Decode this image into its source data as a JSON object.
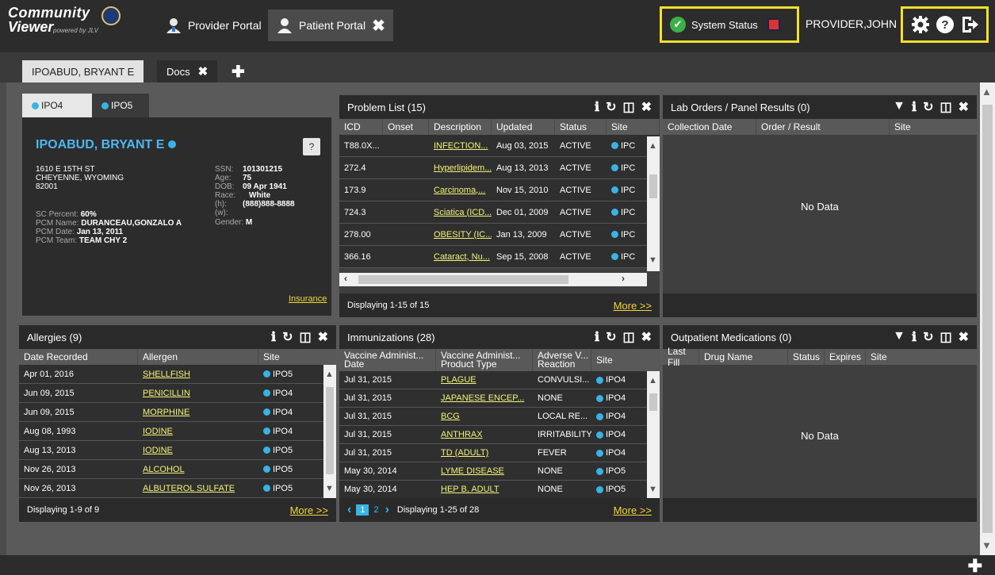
{
  "app": {
    "logo_line1": "Community",
    "logo_line2": "Viewer",
    "logo_sub": "powered by JLV",
    "portal_tabs": [
      "Provider Portal",
      "Patient Portal"
    ],
    "system_status": "System Status",
    "user": "PROVIDER,JOHN",
    "accent_color": "#f2e12a"
  },
  "patient_tabs": {
    "active": "IPOABUD, BRYANT E",
    "docs": "Docs"
  },
  "demographics": {
    "site_tabs": [
      "IPO4",
      "IPO5"
    ],
    "name": "IPOABUD, BRYANT E",
    "address1": "1610 E 15TH ST",
    "address2": "CHEYENNE, WYOMING",
    "zip": "82001",
    "ssn_label": "SSN:",
    "ssn": "101301215",
    "age_label": "Age:",
    "age": "75",
    "dob_label": "DOB:",
    "dob": "09 Apr 1941",
    "race_label": "Race:",
    "race": "White",
    "h_label": "(h):",
    "h": "(888)888-8888",
    "w_label": "(w):",
    "gender_label": "Gender:",
    "gender": "M",
    "sc_label": "SC Percent:",
    "sc": "60%",
    "pcm_name_label": "PCM Name:",
    "pcm_name": "DURANCEAU,GONZALO A",
    "pcm_date_label": "PCM Date:",
    "pcm_date": "Jan 13, 2011",
    "pcm_team_label": "PCM Team:",
    "pcm_team": "TEAM CHY 2",
    "help": "?",
    "insurance": "Insurance"
  },
  "problem_list": {
    "title": "Problem List (15)",
    "headers": [
      "ICD",
      "Onset",
      "Description",
      "Updated",
      "Status",
      "Site"
    ],
    "rows": [
      [
        "T88.0X...",
        "",
        "INFECTION...",
        "Aug 03, 2015",
        "ACTIVE",
        "IPC"
      ],
      [
        "272.4",
        "",
        "Hyperlipidem...",
        "Aug 13, 2013",
        "ACTIVE",
        "IPC"
      ],
      [
        "173.9",
        "",
        "Carcinoma,...",
        "Nov 15, 2010",
        "ACTIVE",
        "IPC"
      ],
      [
        "724.3",
        "",
        "Sciatica (ICD...",
        "Dec 01, 2009",
        "ACTIVE",
        "IPC"
      ],
      [
        "278.00",
        "",
        "OBESITY (IC...",
        "Jan 13, 2009",
        "ACTIVE",
        "IPC"
      ],
      [
        "366.16",
        "",
        "Cataract, Nu...",
        "Sep 15, 2008",
        "ACTIVE",
        "IPC"
      ]
    ],
    "footer": "Displaying 1-15 of 15",
    "more": "More >>"
  },
  "lab_orders": {
    "title": "Lab Orders / Panel Results (0)",
    "headers": [
      "Collection Date",
      "Order / Result",
      "Site"
    ],
    "empty": "No Data"
  },
  "allergies": {
    "title": "Allergies (9)",
    "headers": [
      "Date Recorded",
      "Allergen",
      "Site"
    ],
    "rows": [
      [
        "Apr 01, 2016",
        "SHELLFISH",
        "IPO5"
      ],
      [
        "Jun 09, 2015",
        "PENICILLIN",
        "IPO4"
      ],
      [
        "Jun 09, 2015",
        "MORPHINE",
        "IPO4"
      ],
      [
        "Aug 08, 1993",
        "IODINE",
        "IPO4"
      ],
      [
        "Aug 13, 2013",
        "IODINE",
        "IPO5"
      ],
      [
        "Nov 26, 2013",
        "ALCOHOL",
        "IPO5"
      ],
      [
        "Nov 26, 2013",
        "ALBUTEROL SULFATE",
        "IPO5"
      ]
    ],
    "footer": "Displaying 1-9 of 9",
    "more": "More >>"
  },
  "immunizations": {
    "title": "Immunizations (28)",
    "headers": [
      "Vaccine Administ... Date",
      "Vaccine Administ... Product Type",
      "Adverse V... Reaction",
      "Site"
    ],
    "rows": [
      [
        "Jul 31, 2015",
        "PLAGUE",
        "CONVULSI...",
        "IPO4"
      ],
      [
        "Jul 31, 2015",
        "JAPANESE ENCEP...",
        "NONE",
        "IPO4"
      ],
      [
        "Jul 31, 2015",
        "BCG",
        "LOCAL RE...",
        "IPO4"
      ],
      [
        "Jul 31, 2015",
        "ANTHRAX",
        "IRRITABILITY",
        "IPO4"
      ],
      [
        "Jul 31, 2015",
        "TD (ADULT)",
        "FEVER",
        "IPO4"
      ],
      [
        "May 30, 2014",
        "LYME DISEASE",
        "NONE",
        "IPO5"
      ],
      [
        "May 30, 2014",
        "HEP B, ADULT",
        "NONE",
        "IPO5"
      ]
    ],
    "pages": [
      "1",
      "2"
    ],
    "footer": "Displaying 1-25 of 28",
    "more": "More >>"
  },
  "outpatient": {
    "title": "Outpatient Medications (0)",
    "headers": [
      "Last Fill",
      "Drug Name",
      "Status",
      "Expires",
      "Site"
    ],
    "empty": "No Data"
  },
  "icons": [
    "gear-icon",
    "help-icon",
    "logout-icon",
    "info-icon",
    "refresh-icon",
    "columns-icon",
    "close-icon",
    "filter-icon",
    "plus-icon"
  ]
}
